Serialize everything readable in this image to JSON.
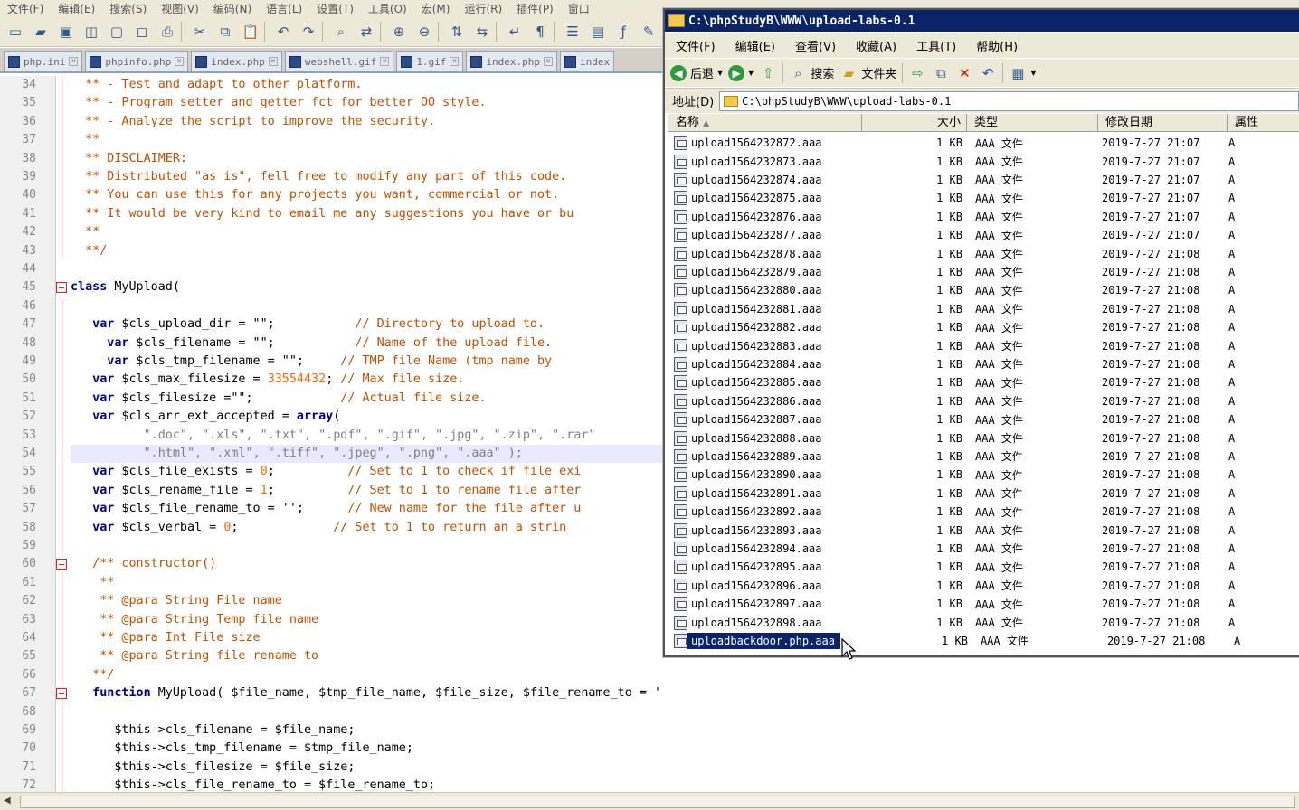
{
  "editor": {
    "menu": [
      "文件(F)",
      "编辑(E)",
      "搜索(S)",
      "视图(V)",
      "编码(N)",
      "语言(L)",
      "设置(T)",
      "工具(O)",
      "宏(M)",
      "运行(R)",
      "插件(P)",
      "窗口"
    ],
    "tabs": [
      "php.ini",
      "phpinfo.php",
      "index.php",
      "webshell.gif",
      "1.gif",
      "index.php",
      "index"
    ],
    "line_numbers": [
      "34",
      "35",
      "36",
      "37",
      "38",
      "39",
      "40",
      "41",
      "42",
      "43",
      "44",
      "45",
      "46",
      "47",
      "48",
      "49",
      "50",
      "51",
      "52",
      "53",
      "54",
      "55",
      "56",
      "57",
      "58",
      "59",
      "60",
      "61",
      "62",
      "63",
      "64",
      "65",
      "66",
      "67",
      "68",
      "69",
      "70",
      "71",
      "72"
    ]
  },
  "code": {
    "l34": "** - Test and adapt to other platform.",
    "l35": "** - Program setter and getter fct for better OO style.",
    "l36": "** - Analyze the script to improve the security.",
    "l37": "**",
    "l38": "** DISCLAIMER:",
    "l39": "** Distributed \"as is\", fell free to modify any part of this code.",
    "l40": "** You can use this for any projects you want, commercial or not.",
    "l41": "** It would be very kind to email me any suggestions you have or bu",
    "l42": "**",
    "l43": "**/",
    "l45_kw": "class",
    "l45_rest": " MyUpload(",
    "l47_kw": "var",
    "l47_var": " $cls_upload_dir = \"\";",
    "l47_cmt": "// Directory to upload to.",
    "l48_kw": "var",
    "l48_var": " $cls_filename = \"\";",
    "l48_cmt": "// Name of the upload file.",
    "l49_kw": "var",
    "l49_var": " $cls_tmp_filename = \"\";",
    "l49_cmt": "// TMP file Name (tmp name by",
    "l50_kw": "var",
    "l50_var": " $cls_max_filesize = ",
    "l50_num": "33554432",
    "l50_semi": ";",
    "l50_cmt": "// Max file size.",
    "l51_kw": "var",
    "l51_var": " $cls_filesize =\"\";",
    "l51_cmt": "// Actual file size.",
    "l52_kw": "var",
    "l52_var": " $cls_arr_ext_accepted = ",
    "l52_fn": "array",
    "l52_paren": "(",
    "l53": "\".doc\", \".xls\", \".txt\", \".pdf\", \".gif\", \".jpg\", \".zip\", \".rar\"",
    "l54": "\".html\", \".xml\", \".tiff\", \".jpeg\", \".png\", \".aaa\" );",
    "l55_kw": "var",
    "l55_var": " $cls_file_exists = ",
    "l55_num": "0",
    "l55_semi": ";",
    "l55_cmt": "// Set to 1 to check if file exi",
    "l56_kw": "var",
    "l56_var": " $cls_rename_file = ",
    "l56_num": "1",
    "l56_semi": ";",
    "l56_cmt": "// Set to 1 to rename file after",
    "l57_kw": "var",
    "l57_var": " $cls_file_rename_to = '';",
    "l57_cmt": "// New name for the file after u",
    "l58_kw": "var",
    "l58_var": " $cls_verbal = ",
    "l58_num": "0",
    "l58_semi": ";",
    "l58_cmt": "// Set to 1 to return an a strin",
    "l60": "/** constructor()",
    "l61": "**",
    "l62": "** @para String File name",
    "l63": "** @para String Temp file name",
    "l64": "** @para Int File size",
    "l65": "** @para String file rename to",
    "l66": "**/",
    "l67_kw": "function",
    "l67_rest": " MyUpload( $file_name, $tmp_file_name, $file_size, $file_rename_to = '' ){",
    "l69": "$this->cls_filename = $file_name;",
    "l70": "$this->cls_tmp_filename = $tmp_file_name;",
    "l71": "$this->cls_filesize = $file_size;",
    "l72": "$this->cls_file_rename_to = $file_rename_to;"
  },
  "explorer": {
    "title": "C:\\phpStudyB\\WWW\\upload-labs-0.1",
    "menu": [
      "文件(F)",
      "编辑(E)",
      "查看(V)",
      "收藏(A)",
      "工具(T)",
      "帮助(H)"
    ],
    "back_label": "后退",
    "search_label": "搜索",
    "folders_label": "文件夹",
    "address_label": "地址(D)",
    "address_value": "C:\\phpStudyB\\WWW\\upload-labs-0.1",
    "columns": {
      "name": "名称",
      "size": "大小",
      "type": "类型",
      "modified": "修改日期",
      "attr": "属性"
    },
    "files": [
      {
        "name": "upload1564232872.aaa",
        "size": "1 KB",
        "type": "AAA 文件",
        "modified": "2019-7-27 21:07",
        "attr": "A"
      },
      {
        "name": "upload1564232873.aaa",
        "size": "1 KB",
        "type": "AAA 文件",
        "modified": "2019-7-27 21:07",
        "attr": "A"
      },
      {
        "name": "upload1564232874.aaa",
        "size": "1 KB",
        "type": "AAA 文件",
        "modified": "2019-7-27 21:07",
        "attr": "A"
      },
      {
        "name": "upload1564232875.aaa",
        "size": "1 KB",
        "type": "AAA 文件",
        "modified": "2019-7-27 21:07",
        "attr": "A"
      },
      {
        "name": "upload1564232876.aaa",
        "size": "1 KB",
        "type": "AAA 文件",
        "modified": "2019-7-27 21:07",
        "attr": "A"
      },
      {
        "name": "upload1564232877.aaa",
        "size": "1 KB",
        "type": "AAA 文件",
        "modified": "2019-7-27 21:07",
        "attr": "A"
      },
      {
        "name": "upload1564232878.aaa",
        "size": "1 KB",
        "type": "AAA 文件",
        "modified": "2019-7-27 21:08",
        "attr": "A"
      },
      {
        "name": "upload1564232879.aaa",
        "size": "1 KB",
        "type": "AAA 文件",
        "modified": "2019-7-27 21:08",
        "attr": "A"
      },
      {
        "name": "upload1564232880.aaa",
        "size": "1 KB",
        "type": "AAA 文件",
        "modified": "2019-7-27 21:08",
        "attr": "A"
      },
      {
        "name": "upload1564232881.aaa",
        "size": "1 KB",
        "type": "AAA 文件",
        "modified": "2019-7-27 21:08",
        "attr": "A"
      },
      {
        "name": "upload1564232882.aaa",
        "size": "1 KB",
        "type": "AAA 文件",
        "modified": "2019-7-27 21:08",
        "attr": "A"
      },
      {
        "name": "upload1564232883.aaa",
        "size": "1 KB",
        "type": "AAA 文件",
        "modified": "2019-7-27 21:08",
        "attr": "A"
      },
      {
        "name": "upload1564232884.aaa",
        "size": "1 KB",
        "type": "AAA 文件",
        "modified": "2019-7-27 21:08",
        "attr": "A"
      },
      {
        "name": "upload1564232885.aaa",
        "size": "1 KB",
        "type": "AAA 文件",
        "modified": "2019-7-27 21:08",
        "attr": "A"
      },
      {
        "name": "upload1564232886.aaa",
        "size": "1 KB",
        "type": "AAA 文件",
        "modified": "2019-7-27 21:08",
        "attr": "A"
      },
      {
        "name": "upload1564232887.aaa",
        "size": "1 KB",
        "type": "AAA 文件",
        "modified": "2019-7-27 21:08",
        "attr": "A"
      },
      {
        "name": "upload1564232888.aaa",
        "size": "1 KB",
        "type": "AAA 文件",
        "modified": "2019-7-27 21:08",
        "attr": "A"
      },
      {
        "name": "upload1564232889.aaa",
        "size": "1 KB",
        "type": "AAA 文件",
        "modified": "2019-7-27 21:08",
        "attr": "A"
      },
      {
        "name": "upload1564232890.aaa",
        "size": "1 KB",
        "type": "AAA 文件",
        "modified": "2019-7-27 21:08",
        "attr": "A"
      },
      {
        "name": "upload1564232891.aaa",
        "size": "1 KB",
        "type": "AAA 文件",
        "modified": "2019-7-27 21:08",
        "attr": "A"
      },
      {
        "name": "upload1564232892.aaa",
        "size": "1 KB",
        "type": "AAA 文件",
        "modified": "2019-7-27 21:08",
        "attr": "A"
      },
      {
        "name": "upload1564232893.aaa",
        "size": "1 KB",
        "type": "AAA 文件",
        "modified": "2019-7-27 21:08",
        "attr": "A"
      },
      {
        "name": "upload1564232894.aaa",
        "size": "1 KB",
        "type": "AAA 文件",
        "modified": "2019-7-27 21:08",
        "attr": "A"
      },
      {
        "name": "upload1564232895.aaa",
        "size": "1 KB",
        "type": "AAA 文件",
        "modified": "2019-7-27 21:08",
        "attr": "A"
      },
      {
        "name": "upload1564232896.aaa",
        "size": "1 KB",
        "type": "AAA 文件",
        "modified": "2019-7-27 21:08",
        "attr": "A"
      },
      {
        "name": "upload1564232897.aaa",
        "size": "1 KB",
        "type": "AAA 文件",
        "modified": "2019-7-27 21:08",
        "attr": "A"
      },
      {
        "name": "upload1564232898.aaa",
        "size": "1 KB",
        "type": "AAA 文件",
        "modified": "2019-7-27 21:08",
        "attr": "A"
      },
      {
        "name": "uploadbackdoor.php.aaa",
        "size": "1 KB",
        "type": "AAA 文件",
        "modified": "2019-7-27 21:08",
        "attr": "A",
        "selected": true
      }
    ]
  }
}
